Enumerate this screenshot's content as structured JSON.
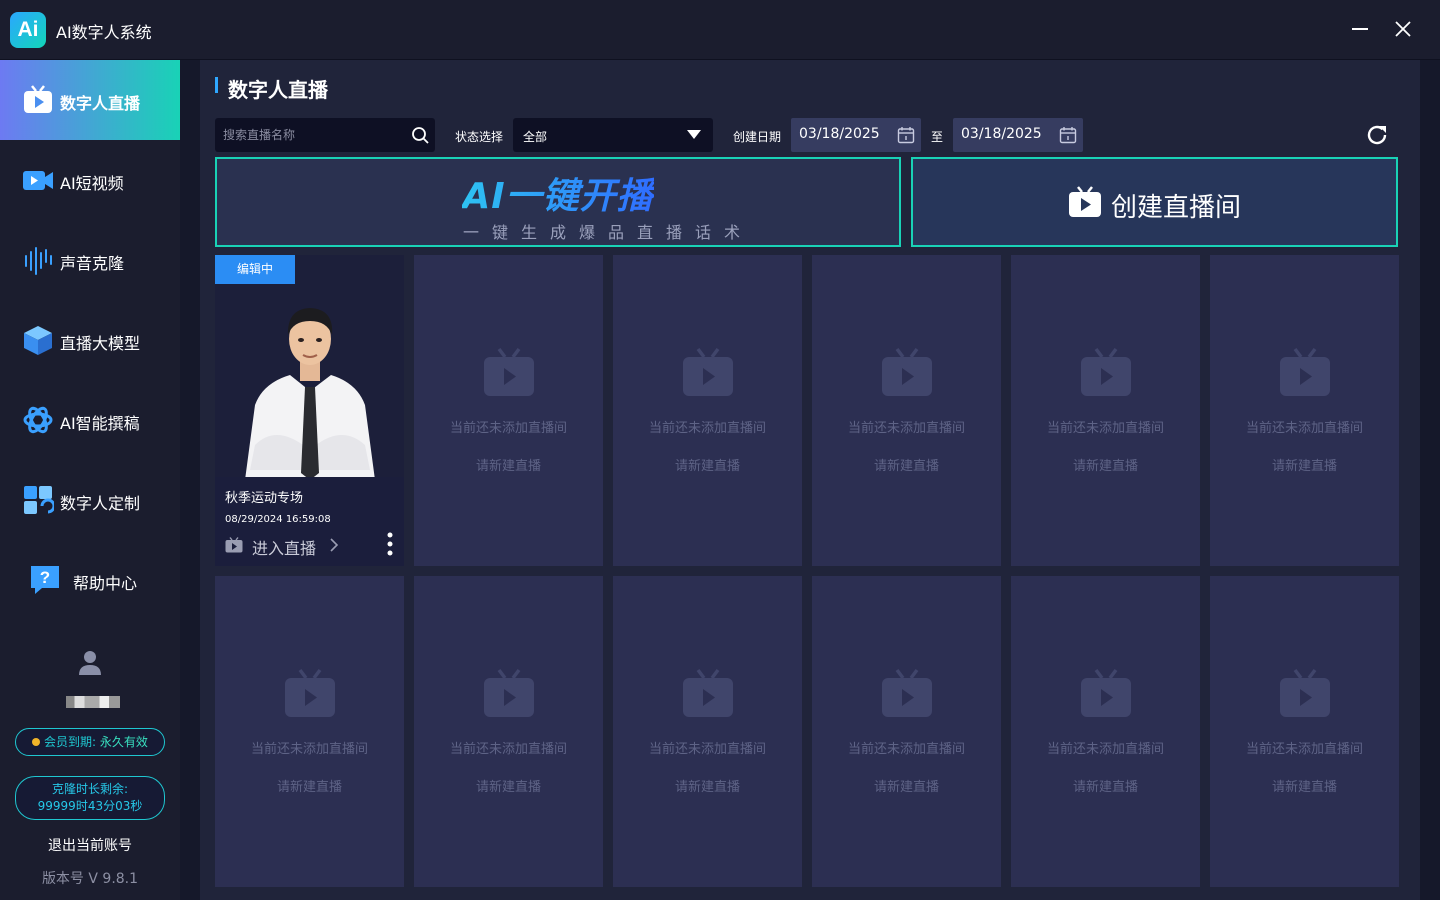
{
  "app": {
    "logo_text": "Ai",
    "title": "AI数字人系统"
  },
  "sidebar": {
    "items": [
      {
        "label": "数字人直播",
        "icon": "tv-play-icon",
        "active": true
      },
      {
        "label": "AI短视频",
        "icon": "video-camera-icon",
        "active": false
      },
      {
        "label": "声音克隆",
        "icon": "sound-wave-icon",
        "active": false
      },
      {
        "label": "直播大模型",
        "icon": "cube-icon",
        "active": false
      },
      {
        "label": "AI智能撰稿",
        "icon": "ai-writing-icon",
        "active": false
      },
      {
        "label": "数字人定制",
        "icon": "customize-icon",
        "active": false
      },
      {
        "label": "帮助中心",
        "icon": "help-icon",
        "active": false
      }
    ],
    "member_label": "会员到期:",
    "member_value": "永久有效",
    "clone_label": "克隆时长剩余:",
    "clone_value": "99999时43分03秒",
    "logout": "退出当前账号",
    "version": "版本号 V 9.8.1"
  },
  "main": {
    "title": "数字人直播",
    "search": {
      "placeholder": "搜索直播名称",
      "value": ""
    },
    "status_label": "状态选择",
    "status_value": "全部",
    "date_label": "创建日期",
    "date_from": "03/18/2025",
    "date_sep": "至",
    "date_to": "03/18/2025",
    "banner_ai": {
      "title": "AI一键开播",
      "subtitle": "一键生成爆品直播话术"
    },
    "banner_create": {
      "label": "创建直播间"
    },
    "live_card": {
      "badge": "编辑中",
      "name": "秋季运动专场",
      "time": "08/29/2024 16:59:08",
      "enter_label": "进入直播"
    },
    "empty_card": {
      "text": "当前还未添加直播间",
      "sub": "请新建直播"
    }
  },
  "colors": {
    "accent": "#19d2b6",
    "primary": "#2b8df4",
    "background": "#20243a",
    "sidebar": "#1b1d2e",
    "card": "#2c2f52"
  }
}
